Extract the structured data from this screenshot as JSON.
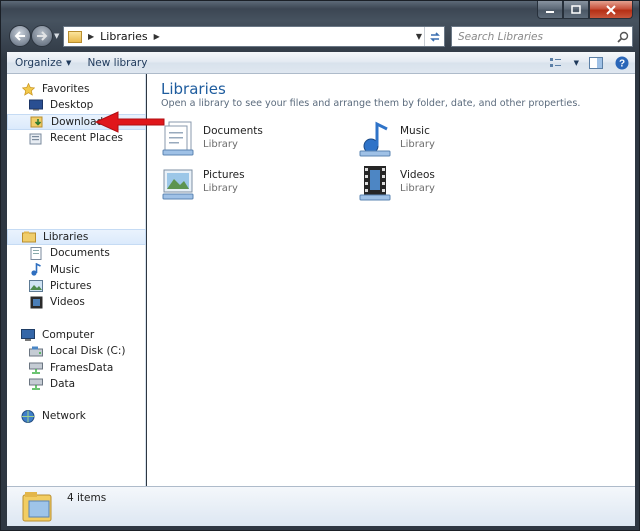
{
  "window": {
    "caption_buttons": [
      "minimize",
      "maximize",
      "close"
    ]
  },
  "address_bar": {
    "breadcrumb": "Libraries",
    "search_placeholder": "Search Libraries"
  },
  "toolbar": {
    "organize_label": "Organize",
    "new_library_label": "New library"
  },
  "nav_pane": {
    "favorites": {
      "label": "Favorites",
      "items": [
        {
          "label": "Desktop",
          "icon": "desktop-icon"
        },
        {
          "label": "Downloads",
          "icon": "downloads-icon"
        },
        {
          "label": "Recent Places",
          "icon": "recent-places-icon"
        }
      ]
    },
    "libraries": {
      "label": "Libraries",
      "items": [
        {
          "label": "Documents",
          "icon": "documents-icon"
        },
        {
          "label": "Music",
          "icon": "music-icon"
        },
        {
          "label": "Pictures",
          "icon": "pictures-icon"
        },
        {
          "label": "Videos",
          "icon": "videos-icon"
        }
      ]
    },
    "computer": {
      "label": "Computer",
      "items": [
        {
          "label": "Local Disk (C:)",
          "icon": "local-disk-icon"
        },
        {
          "label": "FramesData",
          "icon": "network-drive-icon"
        },
        {
          "label": "Data",
          "icon": "network-drive-icon"
        }
      ]
    },
    "network": {
      "label": "Network"
    }
  },
  "content": {
    "title": "Libraries",
    "subtitle": "Open a library to see your files and arrange them by folder, date, and other properties.",
    "libraries": [
      {
        "name": "Documents",
        "type": "Library",
        "icon": "documents-library-icon"
      },
      {
        "name": "Music",
        "type": "Library",
        "icon": "music-library-icon"
      },
      {
        "name": "Pictures",
        "type": "Library",
        "icon": "pictures-library-icon"
      },
      {
        "name": "Videos",
        "type": "Library",
        "icon": "videos-library-icon"
      }
    ]
  },
  "status_bar": {
    "item_count": "4 items"
  },
  "colors": {
    "title_blue": "#1e5c9e",
    "annotation_red": "#e0161b",
    "selection_bg": "#dbeafc"
  }
}
